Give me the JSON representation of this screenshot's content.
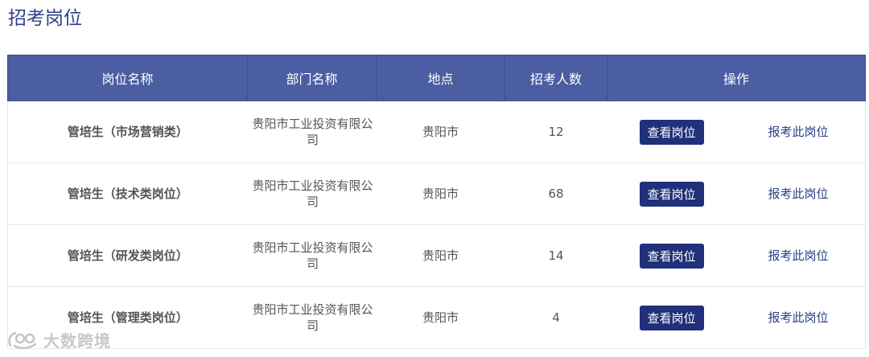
{
  "section": {
    "title": "招考岗位"
  },
  "table": {
    "headers": [
      "岗位名称",
      "部门名称",
      "地点",
      "招考人数",
      "操作"
    ],
    "rows": [
      {
        "name": "管培生（市场营销类）",
        "dept": "贵阳市工业投资有限公司",
        "location": "贵阳市",
        "count": "12",
        "view": "查看岗位",
        "apply": "报考此岗位"
      },
      {
        "name": "管培生（技术类岗位）",
        "dept": "贵阳市工业投资有限公司",
        "location": "贵阳市",
        "count": "68",
        "view": "查看岗位",
        "apply": "报考此岗位"
      },
      {
        "name": "管培生（研发类岗位）",
        "dept": "贵阳市工业投资有限公司",
        "location": "贵阳市",
        "count": "14",
        "view": "查看岗位",
        "apply": "报考此岗位"
      },
      {
        "name": "管培生（管理类岗位）",
        "dept": "贵阳市工业投资有限公司",
        "location": "贵阳市",
        "count": "4",
        "view": "查看岗位",
        "apply": "报考此岗位"
      }
    ]
  },
  "watermark": {
    "text": "大数跨境"
  },
  "colors": {
    "header_bg": "#4a5ea1",
    "button_bg": "#21307a",
    "link": "#2a3f86"
  }
}
